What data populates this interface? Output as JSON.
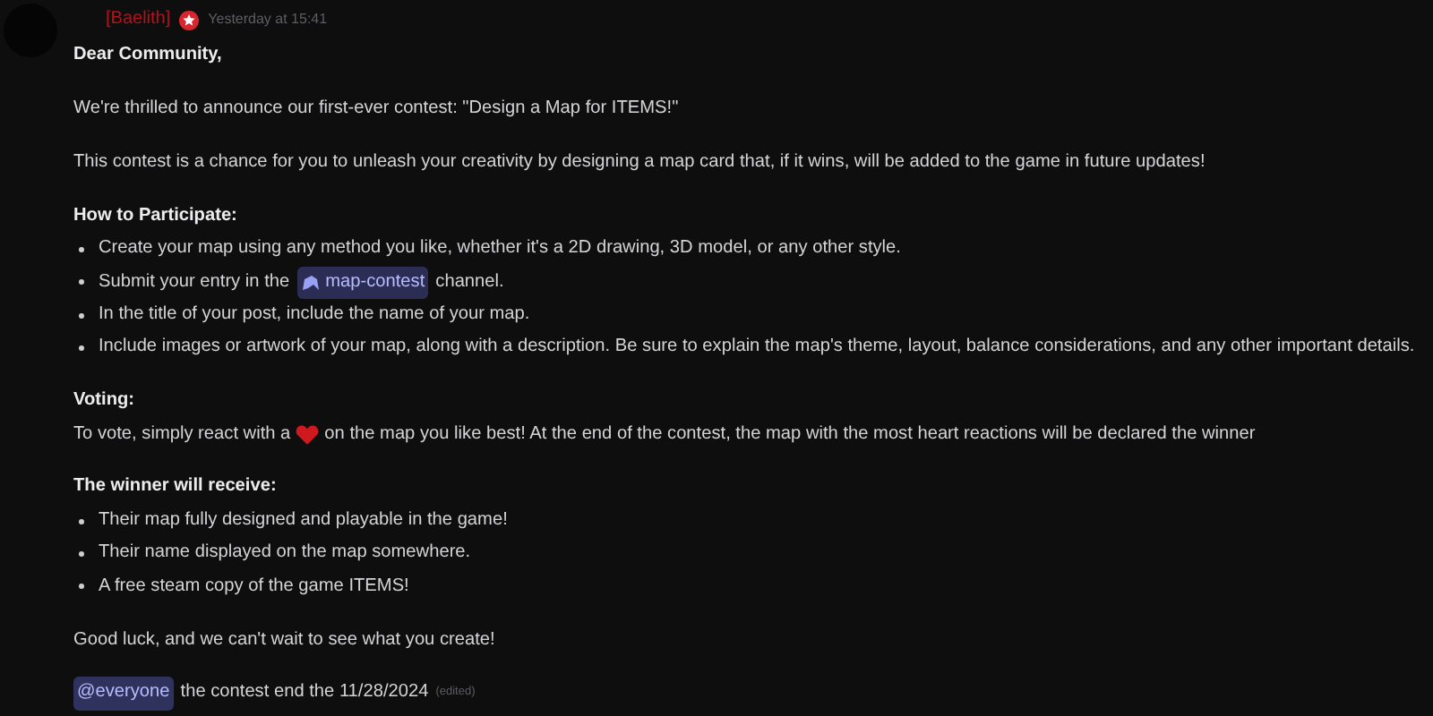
{
  "message": {
    "author": "[Baelith]",
    "timestamp": "Yesterday at 15:41",
    "greeting": "Dear Community,",
    "intro": "We're thrilled to announce our first-ever contest: \"Design a Map for ITEMS!\"",
    "description": "This contest is a chance for you to unleash your creativity by designing a map card that, if it wins, will be added to the game in future updates!",
    "sections": [
      {
        "heading": "How to Participate:",
        "items": [
          {
            "kind": "text",
            "text": "Create your map using any method you like, whether it's a 2D drawing, 3D model, or any other style."
          },
          {
            "kind": "channel",
            "before": "Submit your entry in the",
            "channel": "map-contest",
            "after": "channel."
          },
          {
            "kind": "text",
            "text": "In the title of your post, include the name of your map."
          },
          {
            "kind": "text",
            "text": "Include images or artwork of your map, along with a description. Be sure to explain the map's theme, layout, balance considerations, and any other important details."
          }
        ]
      },
      {
        "heading": "Voting:",
        "before": "To vote, simply react with a",
        "after": "on the map you like best! At the end of the contest, the map with the most heart reactions will be declared the winner"
      },
      {
        "heading": "The winner will receive:",
        "items": [
          {
            "kind": "text",
            "text": "Their map fully designed and playable in the game!"
          },
          {
            "kind": "text",
            "text": "Their name displayed on the map somewhere."
          },
          {
            "kind": "text",
            "text": "A free steam copy of the game ITEMS!"
          }
        ]
      }
    ],
    "closing": "Good luck, and we can't wait to see what you create!",
    "mention": "@everyone",
    "footer": "the contest end the 11/28/2024",
    "edited": "(edited)"
  }
}
